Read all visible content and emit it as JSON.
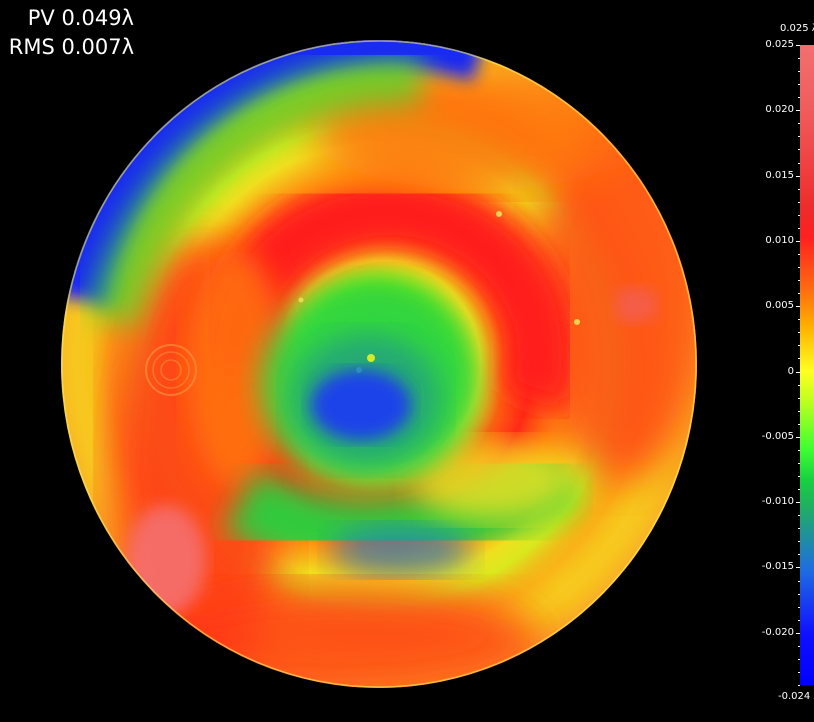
{
  "stats": {
    "pv": "PV 0.049λ",
    "rms": "RMS 0.007λ"
  },
  "colorbar": {
    "max_label": "0.025 λ",
    "min_label": "-0.024 λ",
    "ticks": [
      "0.025",
      "0.020",
      "0.015",
      "0.010",
      "0.005",
      "0",
      "-0.005",
      "-0.010",
      "-0.015",
      "-0.020"
    ],
    "tick_values": [
      0.025,
      0.02,
      0.015,
      0.01,
      0.005,
      0.0,
      -0.005,
      -0.01,
      -0.015,
      -0.02
    ],
    "range": [
      -0.024,
      0.025
    ],
    "colors": {
      "max": "#f36f6f",
      "red": "#ff2020",
      "orange": "#ff8a10",
      "yellow": "#ffff20",
      "green": "#30e040",
      "blue": "#0000ff"
    }
  },
  "map": {
    "background": "#000000",
    "regions": [
      "outer-blue-arc",
      "outer-green-yellow-ring",
      "outer-red-ring",
      "inner-red-arc",
      "center-green-disk",
      "center-blue-spot",
      "lower-green-arc"
    ]
  }
}
